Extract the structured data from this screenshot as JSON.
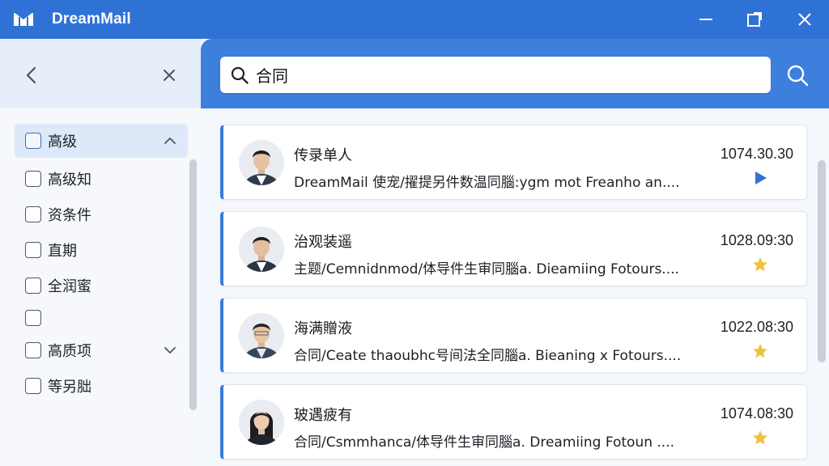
{
  "app": {
    "title": "DreamMail",
    "logo_icon": "envelope-logo-icon",
    "accent": "#2f72d6"
  },
  "search": {
    "value": "合同",
    "placeholder": ""
  },
  "filters": [
    {
      "label": "高级",
      "expander": "chevron-up-icon"
    },
    {
      "label": "高级知"
    },
    {
      "label": "资条件"
    },
    {
      "label": "直期"
    },
    {
      "label": "全润蜜"
    },
    {
      "label": ""
    },
    {
      "label": "高质项",
      "expander": "chevron-down-icon"
    },
    {
      "label": "等另胐"
    }
  ],
  "mails": [
    {
      "sender": "传录单人",
      "preview": "DreamMail 使宠/擢提另件数温同腦:ygm  mot Freanho an....",
      "time": "1074.30.30",
      "flag": "play-icon",
      "avatar": "male-avatar"
    },
    {
      "sender": "治观装遥",
      "preview": "主题/Cemnidnmod/体导件生审同腦a. Dieamiing Fotours....",
      "time": "1028.09:30",
      "flag": "star-icon",
      "avatar": "male-avatar"
    },
    {
      "sender": "海满贈液",
      "preview": "合同/Ceate thaoubhc号间法全同腦a. Bieaning x Fotours....",
      "time": "1022.08:30",
      "flag": "star-icon",
      "avatar": "male-avatar"
    },
    {
      "sender": "玻遇疲有",
      "preview": "合同/Csmmhanca/体导件生审同腦a. Dreamiing Fotoun ....",
      "time": "1074.08:30",
      "flag": "star-icon",
      "avatar": "female-avatar"
    }
  ],
  "colors": {
    "titlebar": "#2f72d6",
    "search_band": "#3d7fdc",
    "card_accent": "#3a7bdc",
    "star": "#f0c23c",
    "play": "#2f72d6"
  }
}
